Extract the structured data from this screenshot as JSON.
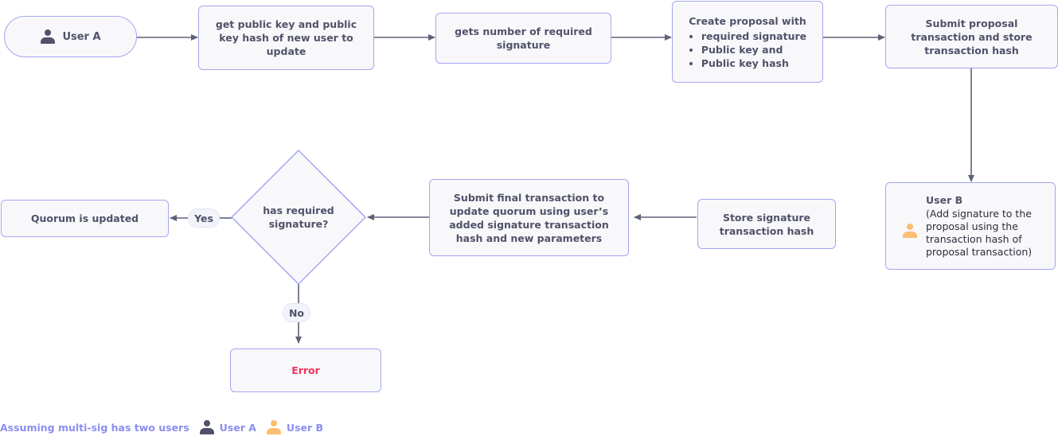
{
  "nodes": {
    "user_a": {
      "label": "User A",
      "icon": "user-icon"
    },
    "get_key": {
      "label": "get public key and public key hash of new user to update"
    },
    "gets_number": {
      "label": "gets number of required signature"
    },
    "create_proposal": {
      "title": "Create proposal with",
      "items": [
        "required signature",
        "Public key and",
        "Public key hash"
      ]
    },
    "submit_proposal": {
      "label": "Submit proposal transaction and store transaction hash"
    },
    "user_b": {
      "title": "User B",
      "label": "(Add signature to the proposal using the transaction hash of proposal transaction)",
      "icon": "user-icon"
    },
    "store_signature": {
      "label": "Store signature transaction hash"
    },
    "submit_final": {
      "label": "Submit final transaction to update quorum using user’s added signature transaction hash and new parameters"
    },
    "decision": {
      "label": "has required signature?"
    },
    "quorum_updated": {
      "label": "Quorum is updated"
    },
    "error": {
      "label": "Error"
    }
  },
  "edges": {
    "yes_label": "Yes",
    "no_label": "No"
  },
  "legend": {
    "text": "Assuming multi-sig has two users",
    "user_a": "User A",
    "user_b": "User B"
  },
  "colors": {
    "border": "#a3a6f3",
    "fill": "#f8f8fb",
    "text": "#50526a",
    "arrow": "#5f6178",
    "error": "#f0325a",
    "user_a": "#4f526a",
    "user_b": "#fcbe71",
    "legend": "#8b8ef0"
  }
}
